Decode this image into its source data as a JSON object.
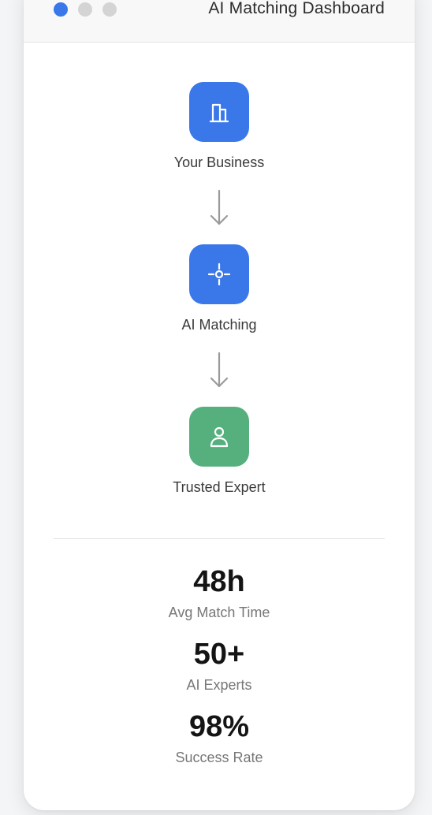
{
  "window": {
    "title": "AI Matching Dashboard",
    "traffic_lights": [
      {
        "name": "active-dot",
        "color": "#3a78ea"
      },
      {
        "name": "inactive-dot",
        "color": "#d4d4d4"
      },
      {
        "name": "inactive-dot",
        "color": "#d4d4d4"
      }
    ]
  },
  "flow": {
    "steps": [
      {
        "label": "Your Business",
        "icon": "building-icon",
        "color": "#3a78ea"
      },
      {
        "label": "AI Matching",
        "icon": "crosshair-icon",
        "color": "#3a78ea"
      },
      {
        "label": "Trusted Expert",
        "icon": "user-icon",
        "color": "#55b07e"
      }
    ],
    "connector_icon": "arrow-down-icon"
  },
  "stats": [
    {
      "value": "48h",
      "label": "Avg Match Time"
    },
    {
      "value": "50+",
      "label": "AI Experts"
    },
    {
      "value": "98%",
      "label": "Success Rate"
    }
  ]
}
